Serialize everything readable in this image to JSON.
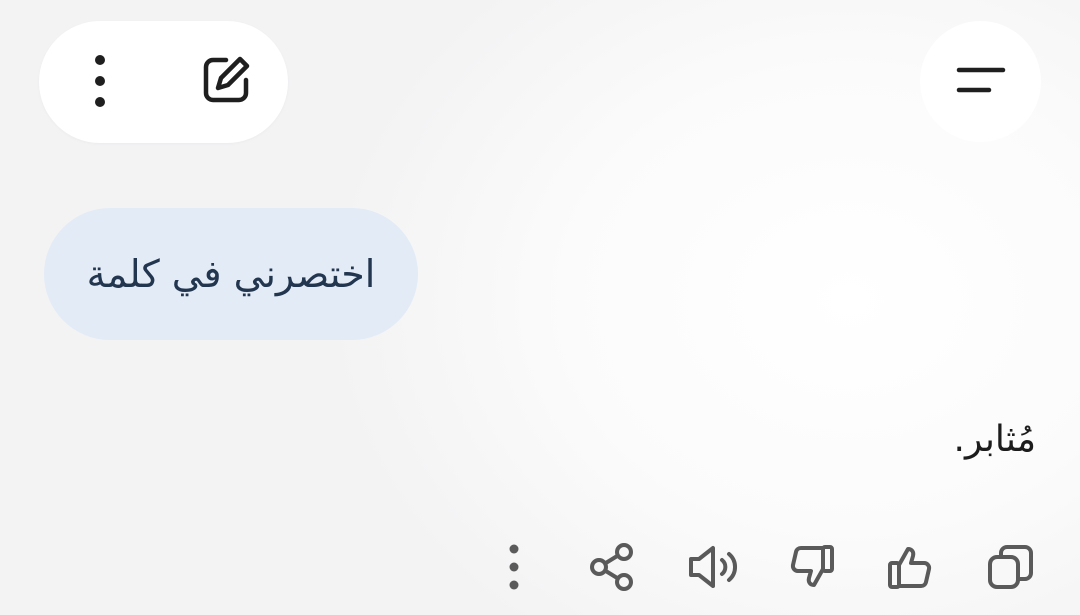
{
  "header": {
    "more_icon": "more-vertical-icon",
    "edit_icon": "edit-square-icon",
    "menu_icon": "menu-icon"
  },
  "conversation": {
    "user_message": "اختصرني في كلمة",
    "assistant_response": "مُثابر."
  },
  "response_actions": [
    {
      "name": "copy",
      "icon": "copy-icon"
    },
    {
      "name": "thumbs-up",
      "icon": "thumbs-up-icon"
    },
    {
      "name": "thumbs-down",
      "icon": "thumbs-down-icon"
    },
    {
      "name": "read-aloud",
      "icon": "speaker-icon"
    },
    {
      "name": "share",
      "icon": "share-icon"
    },
    {
      "name": "more",
      "icon": "more-vertical-icon"
    }
  ],
  "colors": {
    "user_bubble_bg": "#e3ebf6",
    "user_bubble_text": "#23364f",
    "icon_color": "#1f1f1f",
    "action_icon_color": "#5a5a5a"
  }
}
